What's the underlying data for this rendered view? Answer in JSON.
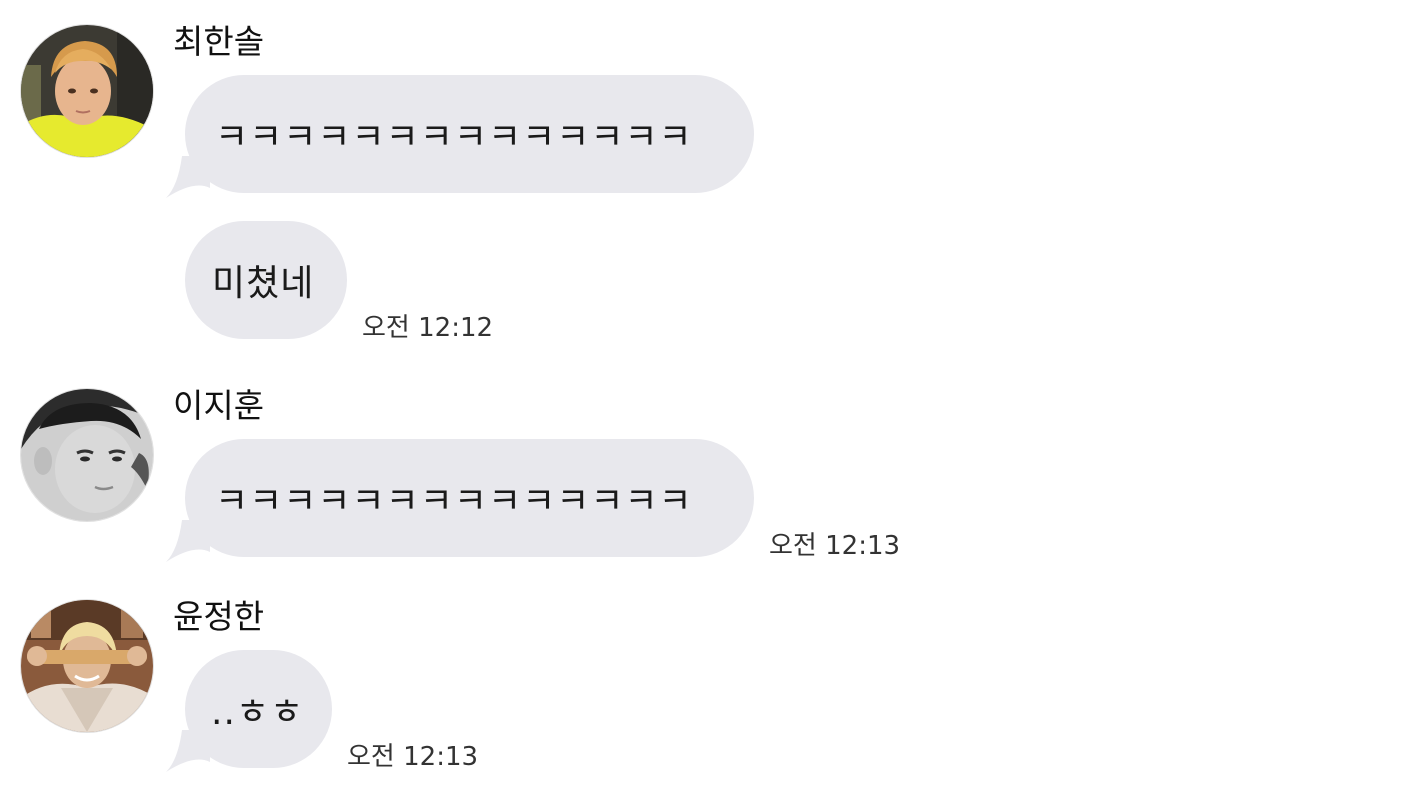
{
  "messages": [
    {
      "sender": "최한솔",
      "text": "ㅋㅋㅋㅋㅋㅋㅋㅋㅋㅋㅋㅋㅋㅋ",
      "avatar_icon": "profile-photo-yellow-shirt"
    },
    {
      "text": "미쳤네",
      "time": "오전 12:12"
    },
    {
      "sender": "이지훈",
      "text": "ㅋㅋㅋㅋㅋㅋㅋㅋㅋㅋㅋㅋㅋㅋ",
      "time": "오전 12:13",
      "avatar_icon": "profile-photo-grayscale"
    },
    {
      "sender": "윤정한",
      "text": "..ㅎㅎ",
      "time": "오전 12:13",
      "avatar_icon": "profile-photo-blond-hair"
    }
  ],
  "colors": {
    "bubble": "#e8e8ed",
    "background": "#ffffff",
    "text": "#111111",
    "timestamp": "#333333"
  }
}
